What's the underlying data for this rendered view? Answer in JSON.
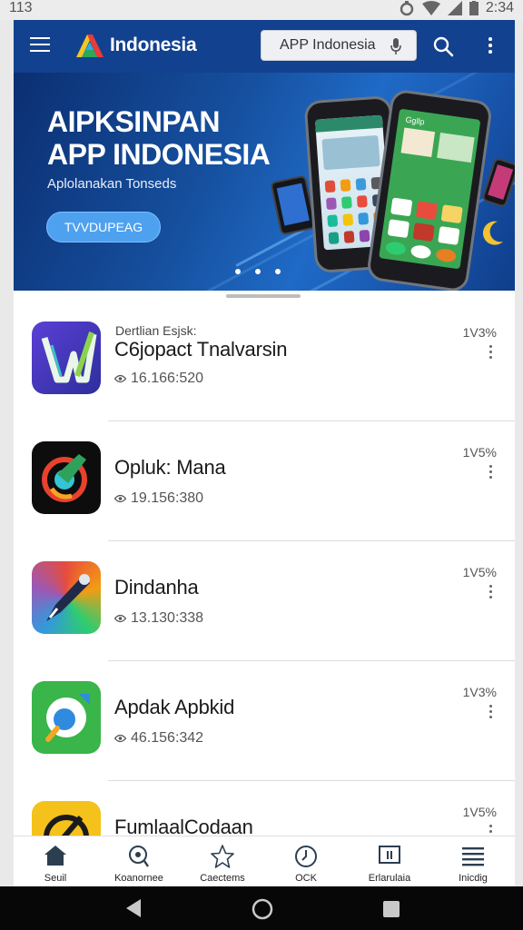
{
  "status_bar": {
    "left_text": "113",
    "time": "2:34"
  },
  "header": {
    "brand": "Indonesia",
    "search_placeholder": "APP Indonesia"
  },
  "banner": {
    "title_line1": "AIPKSINPAN",
    "title_line2": "APP INDONESIA",
    "subtitle": "Aplolanakan Tonseds",
    "button_label": "TVVDUPEAG",
    "phone_screen_label": "Ggllp",
    "carousel_pages": 3
  },
  "apps": [
    {
      "pre": "Dertlian Esjsk:",
      "name": "C6jopact Tnalvarsin",
      "meta": "16.166:520",
      "version": "1V3%"
    },
    {
      "pre": "",
      "name": "Opluk: Mana",
      "meta": "19.156:380",
      "version": "1V5%"
    },
    {
      "pre": "",
      "name": "Dindanha",
      "meta": "13.130:338",
      "version": "1V5%"
    },
    {
      "pre": "",
      "name": "Apdak Apbkid",
      "meta": "46.156:342",
      "version": "1V3%"
    },
    {
      "pre": "",
      "name": "FumlaalCodaan",
      "meta": "",
      "version": "1V5%"
    }
  ],
  "bottom_nav": [
    {
      "label": "Seuil",
      "icon": "home-icon"
    },
    {
      "label": "Koanornee",
      "icon": "search-icon"
    },
    {
      "label": "Caectems",
      "icon": "star-icon"
    },
    {
      "label": "OCK",
      "icon": "clock-icon"
    },
    {
      "label": "Erlarulaia",
      "icon": "window-icon"
    },
    {
      "label": "Inicdig",
      "icon": "list-icon"
    }
  ],
  "colors": {
    "header": "#12418f",
    "banner_button": "#4ea1ef",
    "system_nav": "#070707"
  }
}
